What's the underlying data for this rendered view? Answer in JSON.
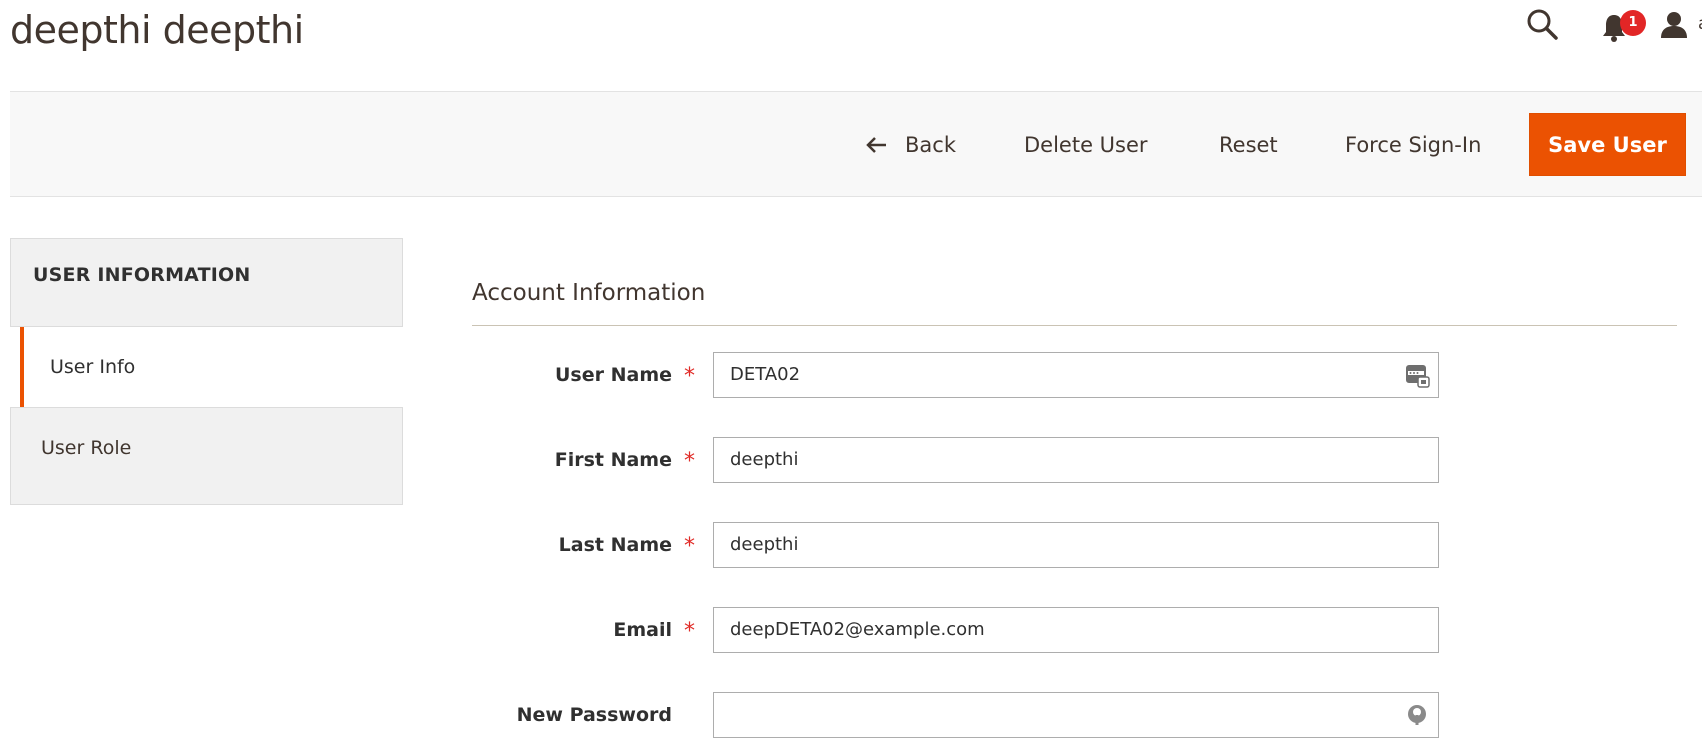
{
  "page": {
    "title": "deepthi deepthi"
  },
  "header": {
    "search_icon": "search-icon",
    "notifications": {
      "icon": "bell-icon",
      "count": "1"
    },
    "user": {
      "icon": "user-icon",
      "name": "admin"
    }
  },
  "toolbar": {
    "back_label": "Back",
    "delete_label": "Delete User",
    "reset_label": "Reset",
    "force_label": "Force Sign-In",
    "save_label": "Save User"
  },
  "sidebar": {
    "heading": "USER INFORMATION",
    "items": [
      {
        "label": "User Info",
        "active": true
      },
      {
        "label": "User Role",
        "active": false
      }
    ]
  },
  "form": {
    "section_title": "Account Information",
    "fields": [
      {
        "label": "User Name",
        "required": "*",
        "value": "DETA02"
      },
      {
        "label": "First Name",
        "required": "*",
        "value": "deepthi"
      },
      {
        "label": "Last Name",
        "required": "*",
        "value": "deepthi"
      },
      {
        "label": "Email",
        "required": "*",
        "value": "deepDETA02@example.com"
      },
      {
        "label": "New Password",
        "required": "",
        "value": ""
      }
    ]
  },
  "colors": {
    "accent": "#eb5202",
    "badge": "#e22626",
    "required": "#e02b27"
  }
}
